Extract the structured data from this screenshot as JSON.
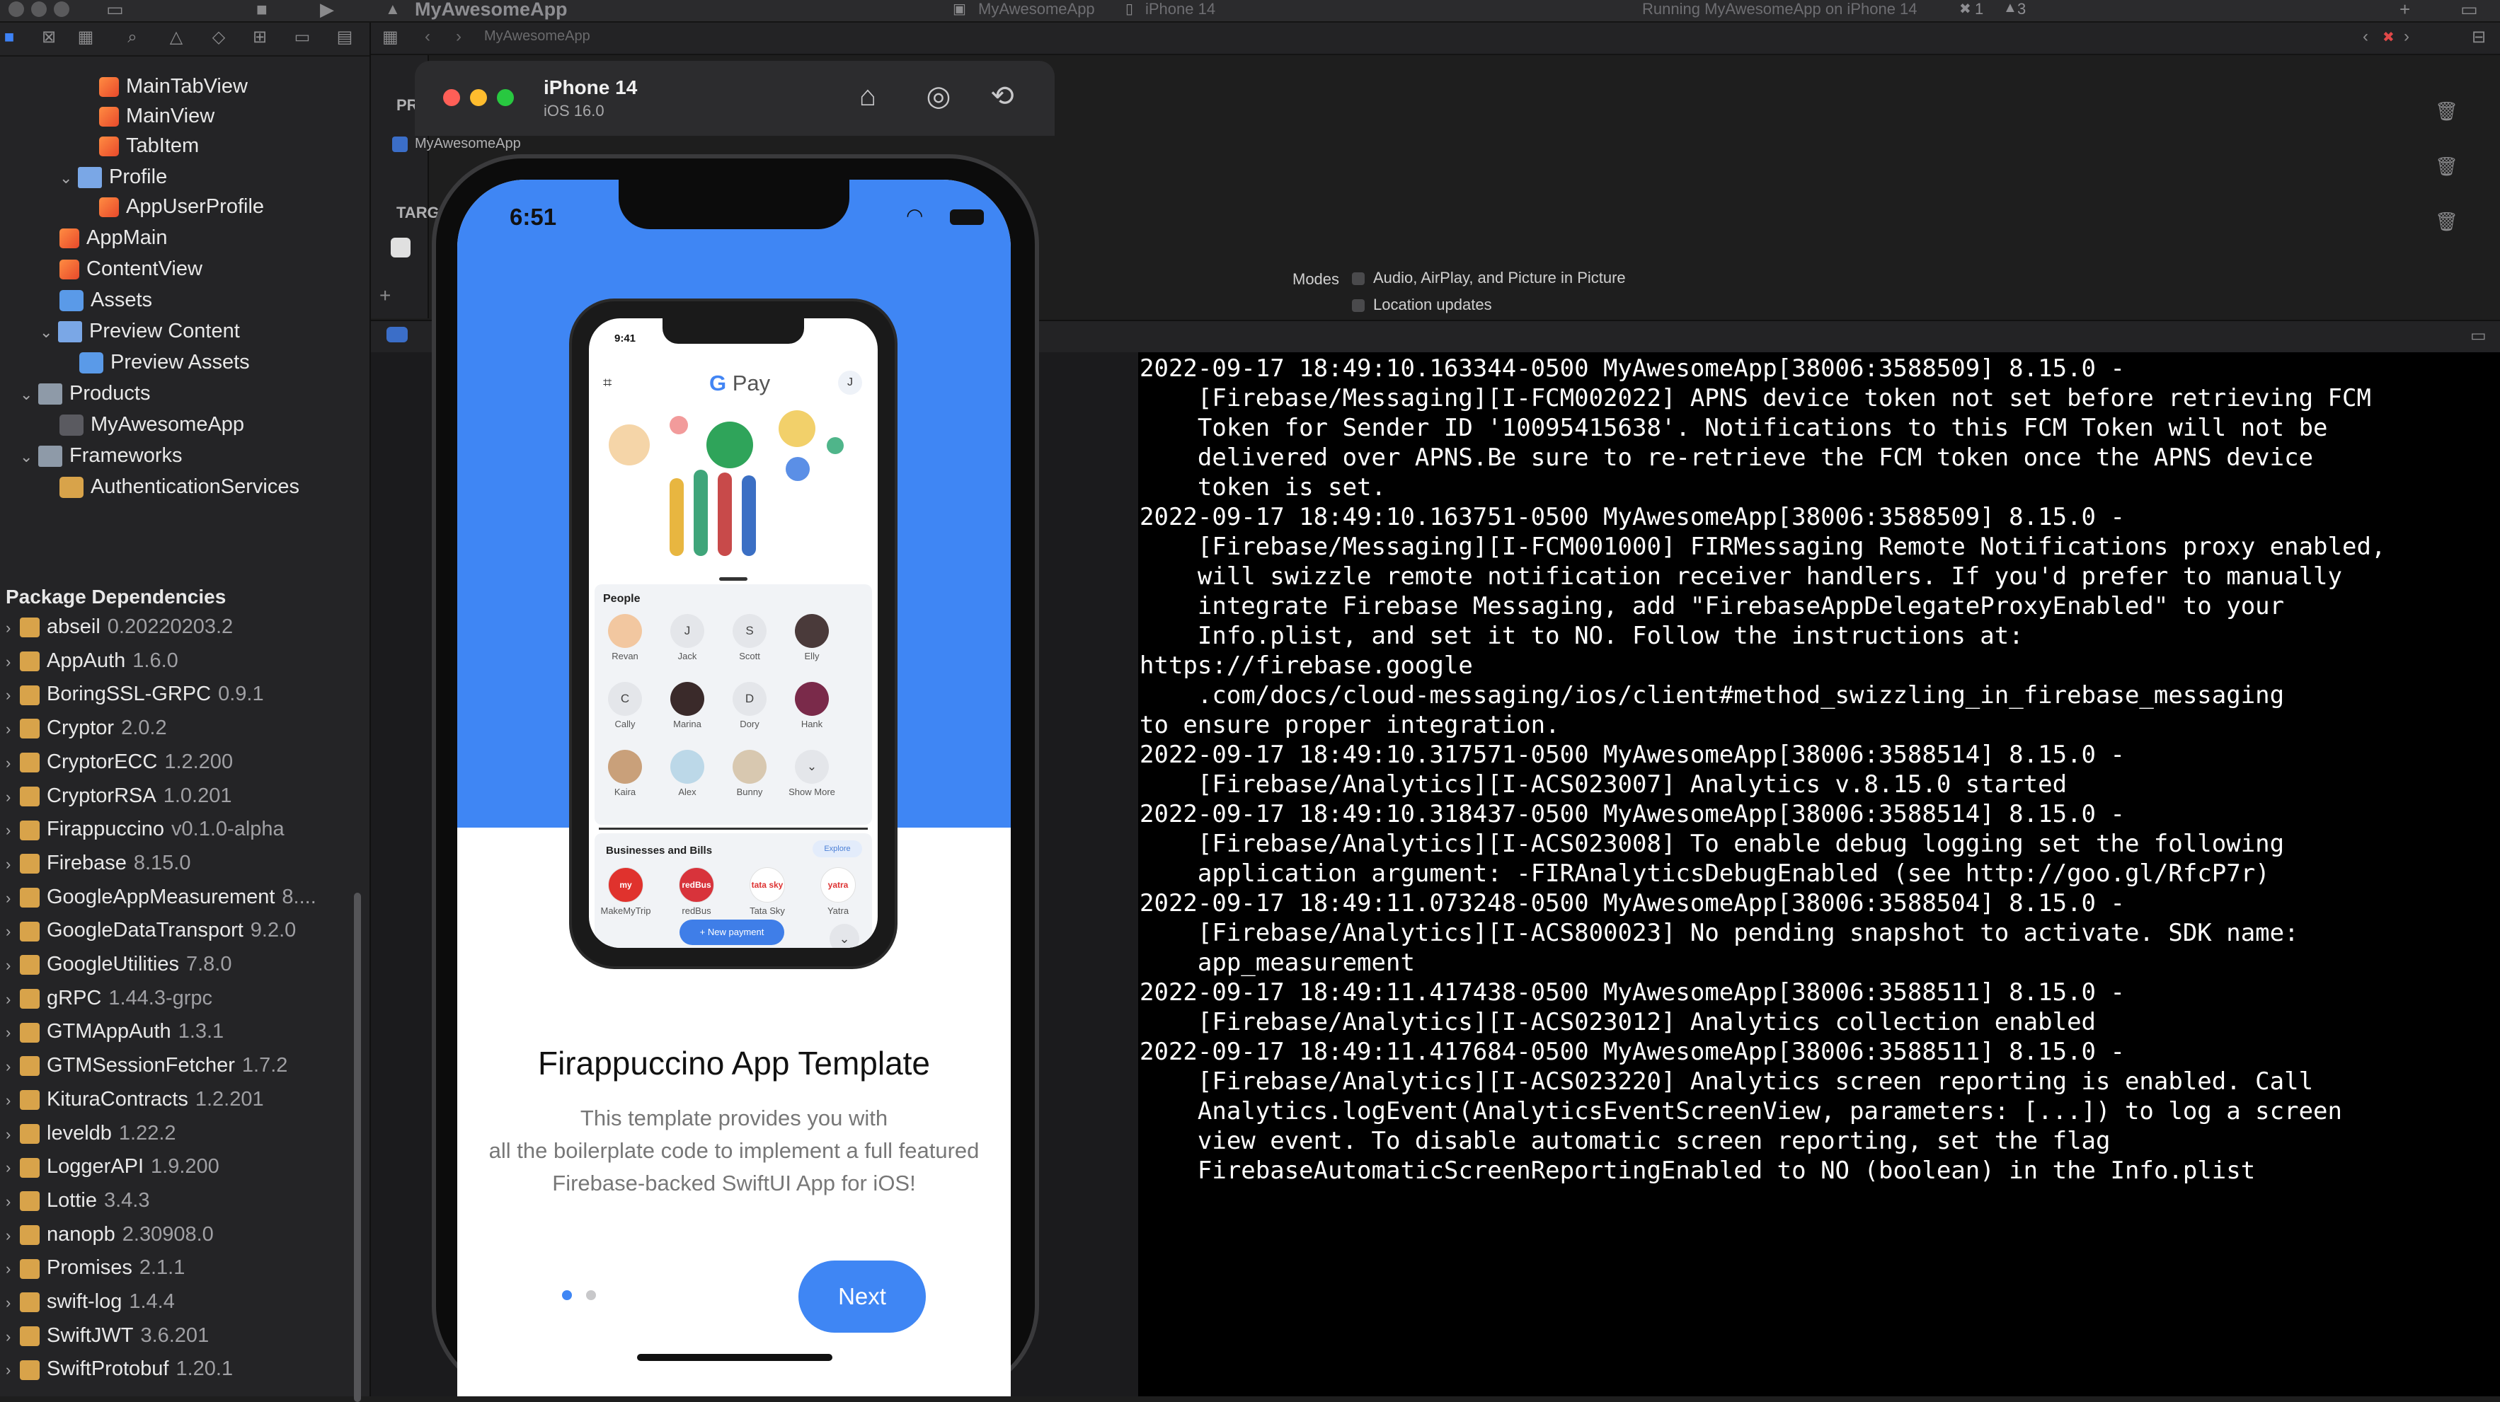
{
  "window": {
    "app_title": "MyAwesomeApp",
    "scheme": "MyAwesomeApp",
    "device": "iPhone 14",
    "run_status": "Running MyAwesomeApp on iPhone 14",
    "errors": "1",
    "warnings": "3"
  },
  "navigator": {
    "tree": [
      {
        "label": "MainTabView",
        "icon": "swift-file-icon"
      },
      {
        "label": "MainView",
        "icon": "swift-file-icon"
      },
      {
        "label": "TabItem",
        "icon": "swift-file-icon"
      },
      {
        "label": "Profile",
        "icon": "folder-icon"
      },
      {
        "label": "AppUserProfile",
        "icon": "swift-file-icon"
      },
      {
        "label": "AppMain",
        "icon": "swift-file-icon"
      },
      {
        "label": "ContentView",
        "icon": "swift-file-icon"
      },
      {
        "label": "Assets",
        "icon": "assets-icon"
      },
      {
        "label": "Preview Content",
        "icon": "folder-icon"
      },
      {
        "label": "Preview Assets",
        "icon": "assets-icon"
      },
      {
        "label": "Products",
        "icon": "folder-icon"
      },
      {
        "label": "MyAwesomeApp",
        "icon": "app-icon"
      },
      {
        "label": "Frameworks",
        "icon": "folder-icon"
      },
      {
        "label": "AuthenticationServices",
        "icon": "toolbox-icon"
      }
    ],
    "packages_header": "Package Dependencies",
    "packages": [
      {
        "name": "abseil",
        "version": "0.20220203.2"
      },
      {
        "name": "AppAuth",
        "version": "1.6.0"
      },
      {
        "name": "BoringSSL-GRPC",
        "version": "0.9.1"
      },
      {
        "name": "Cryptor",
        "version": "2.0.2"
      },
      {
        "name": "CryptorECC",
        "version": "1.2.200"
      },
      {
        "name": "CryptorRSA",
        "version": "1.0.201"
      },
      {
        "name": "Firappuccino",
        "version": "v0.1.0-alpha"
      },
      {
        "name": "Firebase",
        "version": "8.15.0"
      },
      {
        "name": "GoogleAppMeasurement",
        "version": "8...."
      },
      {
        "name": "GoogleDataTransport",
        "version": "9.2.0"
      },
      {
        "name": "GoogleUtilities",
        "version": "7.8.0"
      },
      {
        "name": "gRPC",
        "version": "1.44.3-grpc"
      },
      {
        "name": "GTMAppAuth",
        "version": "1.3.1"
      },
      {
        "name": "GTMSessionFetcher",
        "version": "1.7.2"
      },
      {
        "name": "KituraContracts",
        "version": "1.2.201"
      },
      {
        "name": "leveldb",
        "version": "1.22.2"
      },
      {
        "name": "LoggerAPI",
        "version": "1.9.200"
      },
      {
        "name": "Lottie",
        "version": "3.4.3"
      },
      {
        "name": "nanopb",
        "version": "2.30908.0"
      },
      {
        "name": "Promises",
        "version": "2.1.1"
      },
      {
        "name": "swift-log",
        "version": "1.4.4"
      },
      {
        "name": "SwiftJWT",
        "version": "3.6.201"
      },
      {
        "name": "SwiftProtobuf",
        "version": "1.20.1"
      }
    ]
  },
  "editor": {
    "partial_pr": "PR",
    "partial_targ": "TARG",
    "project_item": "MyAwesomeApp",
    "modes_label": "Modes",
    "mode_options": [
      "Audio, AirPlay, and Picture in Picture",
      "Location updates"
    ]
  },
  "simulator": {
    "device_name": "iPhone 14",
    "os_version": "iOS 16.0",
    "status_time": "6:51",
    "mock": {
      "time": "9:41",
      "app_name_g": "G",
      "app_name_rest": " Pay",
      "avatar_initial": "J",
      "people_label": "People",
      "people": [
        {
          "name": "Revan",
          "initial": ""
        },
        {
          "name": "Jack",
          "initial": "J"
        },
        {
          "name": "Scott",
          "initial": "S"
        },
        {
          "name": "Elly",
          "initial": ""
        },
        {
          "name": "Cally",
          "initial": "C"
        },
        {
          "name": "Marina",
          "initial": ""
        },
        {
          "name": "Dory",
          "initial": "D"
        },
        {
          "name": "Hank",
          "initial": ""
        },
        {
          "name": "Kaira",
          "initial": ""
        },
        {
          "name": "Alex",
          "initial": ""
        },
        {
          "name": "Bunny",
          "initial": ""
        },
        {
          "name": "Show More",
          "initial": "⌄"
        }
      ],
      "biz_label": "Businesses and Bills",
      "explore": "Explore",
      "businesses": [
        {
          "name": "MakeMyTrip",
          "logo": "my",
          "color": "#e0322d"
        },
        {
          "name": "redBus",
          "logo": "redBus",
          "color": "#d8333b"
        },
        {
          "name": "Tata Sky",
          "logo": "tata sky",
          "color": "#ffffff"
        },
        {
          "name": "Yatra",
          "logo": "yatra",
          "color": "#ffffff"
        }
      ],
      "new_payment": "+ New payment"
    },
    "onboarding": {
      "title": "Firappuccino App Template",
      "body_lines": [
        "This template provides you with",
        "all the boilerplate code to implement a full featured",
        "Firebase-backed SwiftUI App for iOS!"
      ],
      "next_label": "Next"
    }
  },
  "console": {
    "text": "2022-09-17 18:49:10.163344-0500 MyAwesomeApp[38006:3588509] 8.15.0 -\n    [Firebase/Messaging][I-FCM002022] APNS device token not set before retrieving FCM\n    Token for Sender ID '10095415638'. Notifications to this FCM Token will not be\n    delivered over APNS.Be sure to re-retrieve the FCM token once the APNS device\n    token is set.\n2022-09-17 18:49:10.163751-0500 MyAwesomeApp[38006:3588509] 8.15.0 -\n    [Firebase/Messaging][I-FCM001000] FIRMessaging Remote Notifications proxy enabled,\n    will swizzle remote notification receiver handlers. If you'd prefer to manually\n    integrate Firebase Messaging, add \"FirebaseAppDelegateProxyEnabled\" to your\n    Info.plist, and set it to NO. Follow the instructions at:\nhttps://firebase.google\n    .com/docs/cloud-messaging/ios/client#method_swizzling_in_firebase_messaging\nto ensure proper integration.\n2022-09-17 18:49:10.317571-0500 MyAwesomeApp[38006:3588514] 8.15.0 -\n    [Firebase/Analytics][I-ACS023007] Analytics v.8.15.0 started\n2022-09-17 18:49:10.318437-0500 MyAwesomeApp[38006:3588514] 8.15.0 -\n    [Firebase/Analytics][I-ACS023008] To enable debug logging set the following\n    application argument: -FIRAnalyticsDebugEnabled (see http://goo.gl/RfcP7r)\n2022-09-17 18:49:11.073248-0500 MyAwesomeApp[38006:3588504] 8.15.0 -\n    [Firebase/Analytics][I-ACS800023] No pending snapshot to activate. SDK name:\n    app_measurement\n2022-09-17 18:49:11.417438-0500 MyAwesomeApp[38006:3588511] 8.15.0 -\n    [Firebase/Analytics][I-ACS023012] Analytics collection enabled\n2022-09-17 18:49:11.417684-0500 MyAwesomeApp[38006:3588511] 8.15.0 -\n    [Firebase/Analytics][I-ACS023220] Analytics screen reporting is enabled. Call\n    Analytics.logEvent(AnalyticsEventScreenView, parameters: [...]) to log a screen\n    view event. To disable automatic screen reporting, set the flag\n    FirebaseAutomaticScreenReportingEnabled to NO (boolean) in the Info.plist"
  },
  "colors": {
    "accent_blue": "#3f86f4",
    "console_bg": "#000000",
    "sidebar_bg": "#242426"
  }
}
